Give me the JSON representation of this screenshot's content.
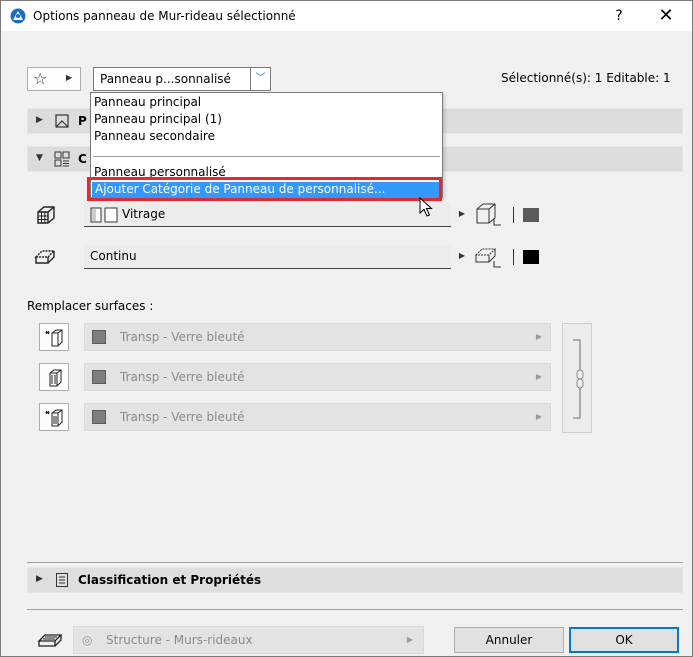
{
  "window": {
    "title": "Options panneau de Mur-rideau sélectionné",
    "help_label": "?",
    "close_label": "✕"
  },
  "toolbar": {
    "preset_value": "Panneau p...sonnalisé",
    "selection_info": "Sélectionné(s): 1 Editable: 1"
  },
  "sections": {
    "first_label": "P",
    "second_label": "C",
    "classification_label": "Classification et Propriétés"
  },
  "dropdown": {
    "items": [
      "Panneau principal",
      "Panneau principal (1)",
      "Panneau secondaire",
      "Panneau personnalisé"
    ],
    "highlighted_item": "Ajouter Catégorie de Panneau de personnalisé..."
  },
  "panel": {
    "type_value": "Vitrage",
    "frame_value": "Continu"
  },
  "surfaces": {
    "label": "Remplacer surfaces :",
    "items": [
      "Transp - Verre bleuté",
      "Transp - Verre bleuté",
      "Transp - Verre bleuté"
    ]
  },
  "footer": {
    "layer_value": "Structure - Murs-rideaux",
    "cancel_label": "Annuler",
    "ok_label": "OK"
  },
  "colors": {
    "highlight": "#3399ff",
    "annotation_red": "#e3292b",
    "ok_border": "#0078d7",
    "section_bg": "#dcdcdc"
  }
}
